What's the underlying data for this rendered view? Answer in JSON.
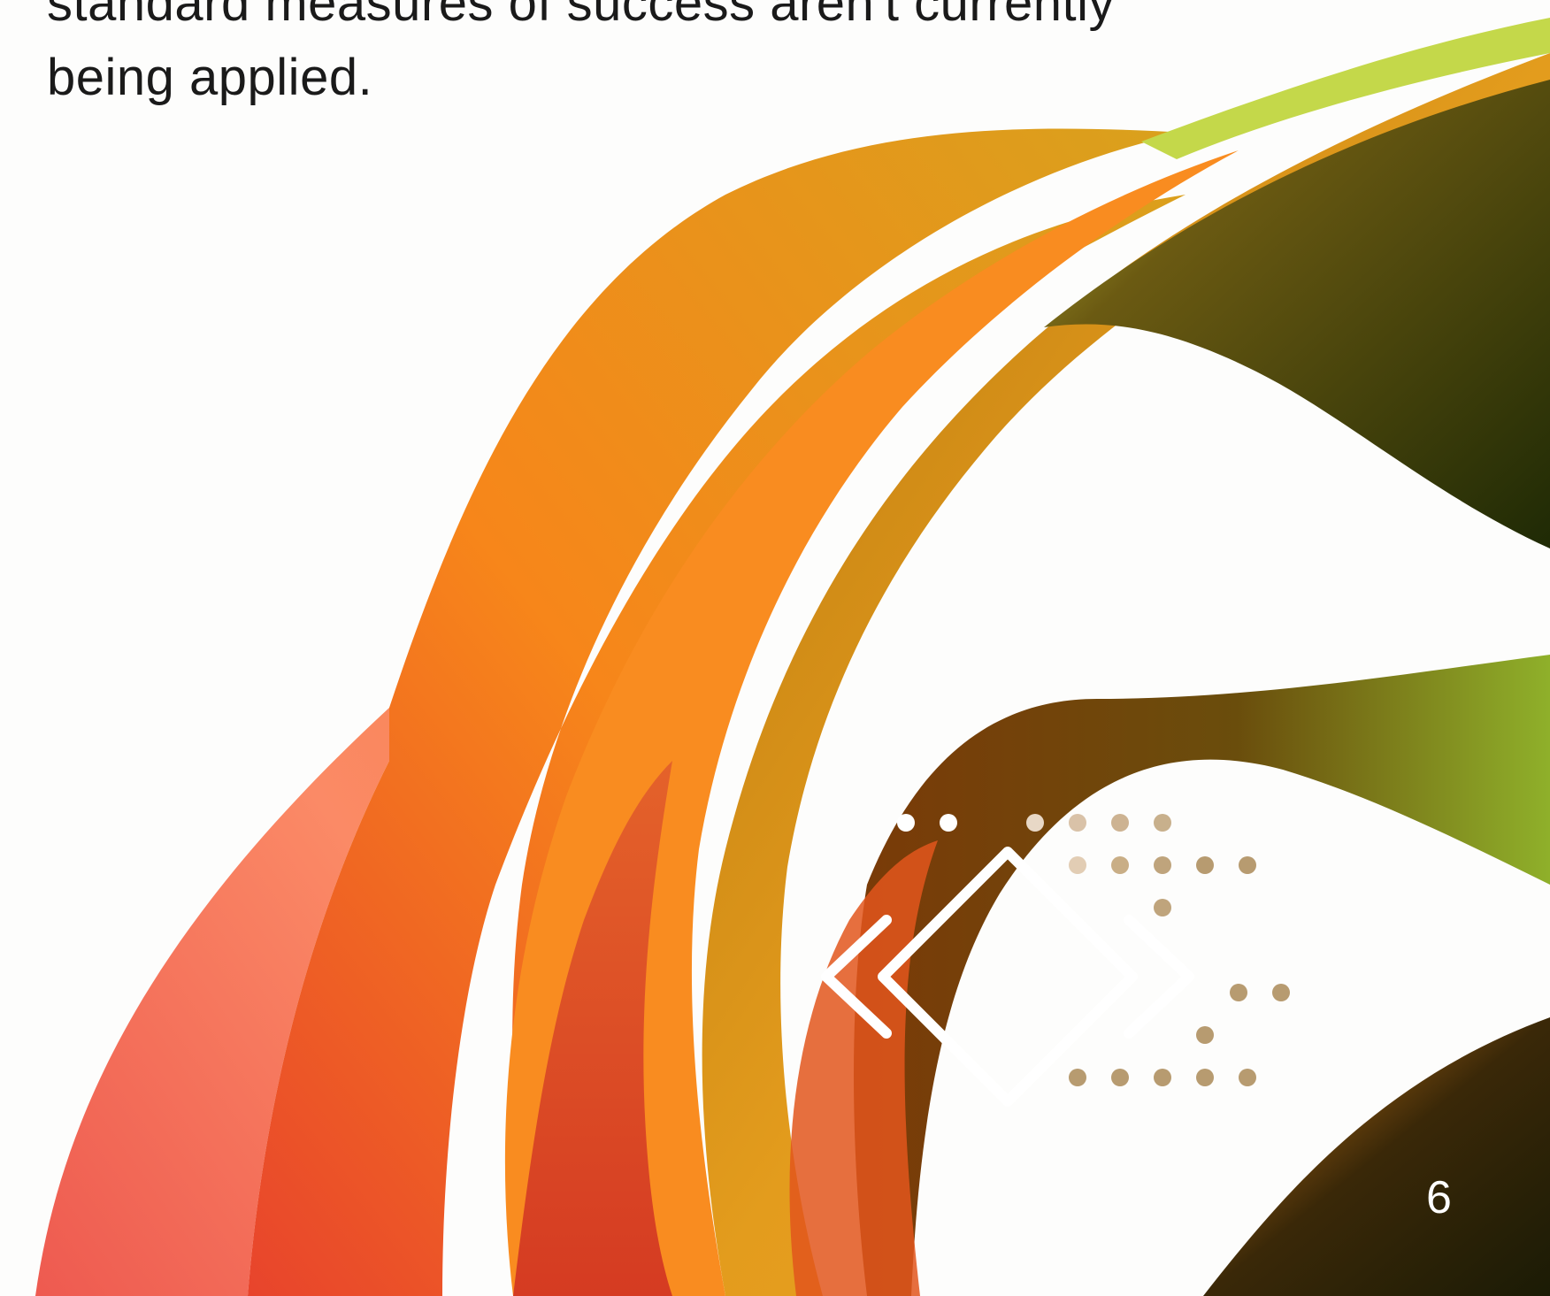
{
  "text": {
    "line1": "standard measures of success aren't currently",
    "line2": "being applied."
  },
  "page_number": "6",
  "colors": {
    "background": "#fdfdfc",
    "text": "#1a1a1a",
    "accent_orange": "#f7921e",
    "accent_coral": "#f46a4e",
    "accent_olive": "#5c4a10",
    "accent_lime": "#b5d84a",
    "emblem": "#ffffff"
  },
  "icons": {
    "emblem": "diamond-chevrons-icon",
    "dots": "dot-grid-decoration"
  }
}
